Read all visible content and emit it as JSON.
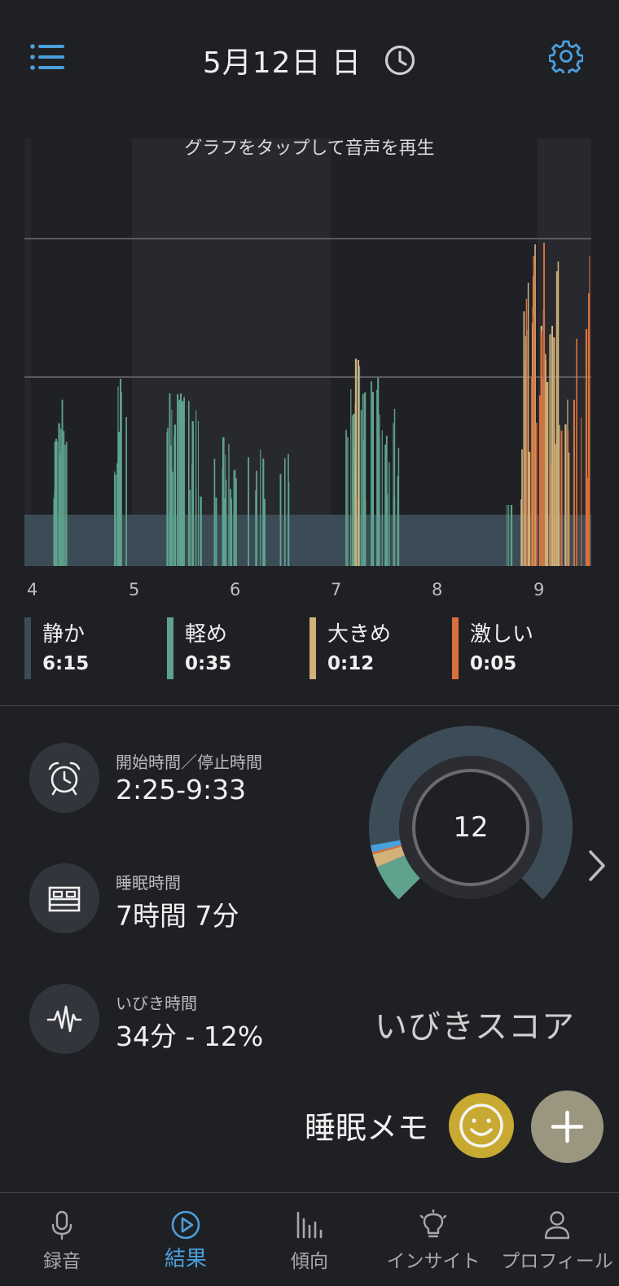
{
  "header": {
    "date_title": "5月12日 日"
  },
  "graph": {
    "hint": "グラフをタップして音声を再生",
    "x_ticks": [
      "4",
      "5",
      "6",
      "7",
      "8",
      "9"
    ]
  },
  "chart_data": {
    "type": "bar",
    "x": [
      "4",
      "5",
      "6",
      "7",
      "8",
      "9"
    ],
    "series": [
      {
        "name": "静か",
        "color": "#3c4c57"
      },
      {
        "name": "軽め",
        "color": "#5fa38d"
      },
      {
        "name": "大きめ",
        "color": "#d1b27a"
      },
      {
        "name": "激しい",
        "color": "#d9703c"
      }
    ]
  },
  "legend": [
    {
      "label": "静か",
      "value": "6:15",
      "color": "#3c4c57"
    },
    {
      "label": "軽め",
      "value": "0:35",
      "color": "#5fa38d"
    },
    {
      "label": "大きめ",
      "value": "0:12",
      "color": "#d1b27a"
    },
    {
      "label": "激しい",
      "value": "0:05",
      "color": "#d9703c"
    }
  ],
  "stats": {
    "start_stop": {
      "label": "開始時間／停止時間",
      "value": "2:25-9:33"
    },
    "sleep_time": {
      "label": "睡眠時間",
      "value": "7時間 7分"
    },
    "snore_time": {
      "label": "いびき時間",
      "value": "34分 - 12%"
    }
  },
  "score": {
    "value": "12",
    "label": "いびきスコア",
    "breakdown": [
      {
        "name": "静か",
        "minutes": 375,
        "color": "#3c4c57"
      },
      {
        "name": "軽め",
        "minutes": 35,
        "color": "#5fa38d"
      },
      {
        "name": "大きめ",
        "minutes": 12,
        "color": "#d1b27a"
      },
      {
        "name": "激しい",
        "minutes": 5,
        "color": "#d9703c"
      }
    ]
  },
  "memo": {
    "label": "睡眠メモ"
  },
  "tabs": [
    {
      "label": "録音",
      "icon": "microphone-icon"
    },
    {
      "label": "結果",
      "icon": "play-circle-icon"
    },
    {
      "label": "傾向",
      "icon": "bar-chart-icon"
    },
    {
      "label": "インサイト",
      "icon": "lightbulb-icon"
    },
    {
      "label": "プロフィール",
      "icon": "person-icon"
    }
  ],
  "colors": {
    "accent": "#4a9fdd",
    "background": "#1f2024"
  }
}
